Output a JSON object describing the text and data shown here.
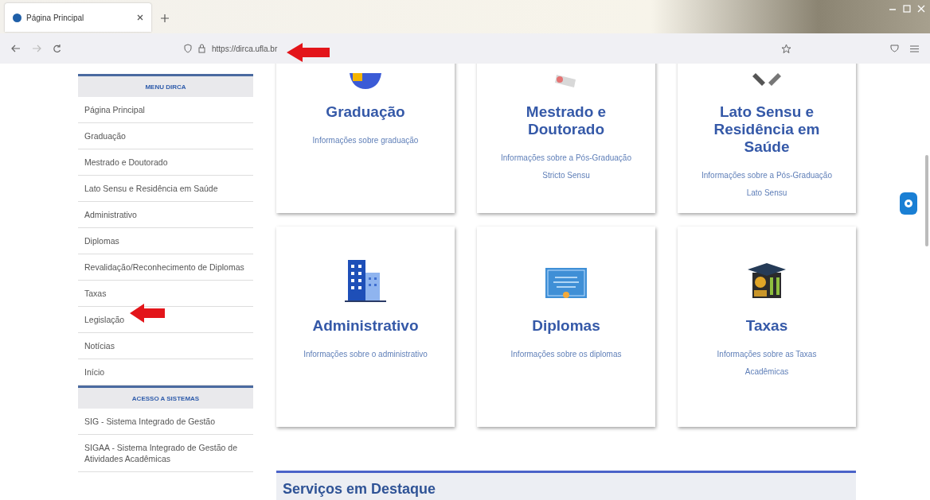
{
  "browser": {
    "tab": {
      "title": "Página Principal"
    },
    "url": "https://dirca.ufla.br"
  },
  "sidebar": {
    "sections": [
      {
        "heading": "MENU DIRCA",
        "items": [
          "Página Principal",
          "Graduação",
          "Mestrado e Doutorado",
          "Lato Sensu e Residência em Saúde",
          "Administrativo",
          "Diplomas",
          "Revalidação/Reconhecimento de Diplomas",
          "Taxas",
          "Legislação",
          "Notícias",
          "Início"
        ]
      },
      {
        "heading": "ACESSO A SISTEMAS",
        "items": [
          "SIG - Sistema Integrado de Gestão",
          "SIGAA - Sistema Integrado de Gestão de Atividades Acadêmicas"
        ]
      }
    ]
  },
  "cards": [
    {
      "kind": "graduation",
      "title": "Graduação",
      "description": "Informações sobre graduação"
    },
    {
      "kind": "masters",
      "title": "Mestrado e Doutorado",
      "description": "Informações sobre a Pós-Graduação Stricto Sensu"
    },
    {
      "kind": "residency",
      "title": "Lato Sensu e Residência em Saúde",
      "description": "Informações sobre a Pós-Graduação Lato Sensu"
    },
    {
      "kind": "building",
      "title": "Administrativo",
      "description": "Informações sobre o administrativo"
    },
    {
      "kind": "diploma",
      "title": "Diplomas",
      "description": "Informações sobre os diplomas"
    },
    {
      "kind": "fees",
      "title": "Taxas",
      "description": "Informações sobre as Taxas Acadêmicas"
    }
  ],
  "featured": {
    "title": "Serviços em Destaque"
  }
}
